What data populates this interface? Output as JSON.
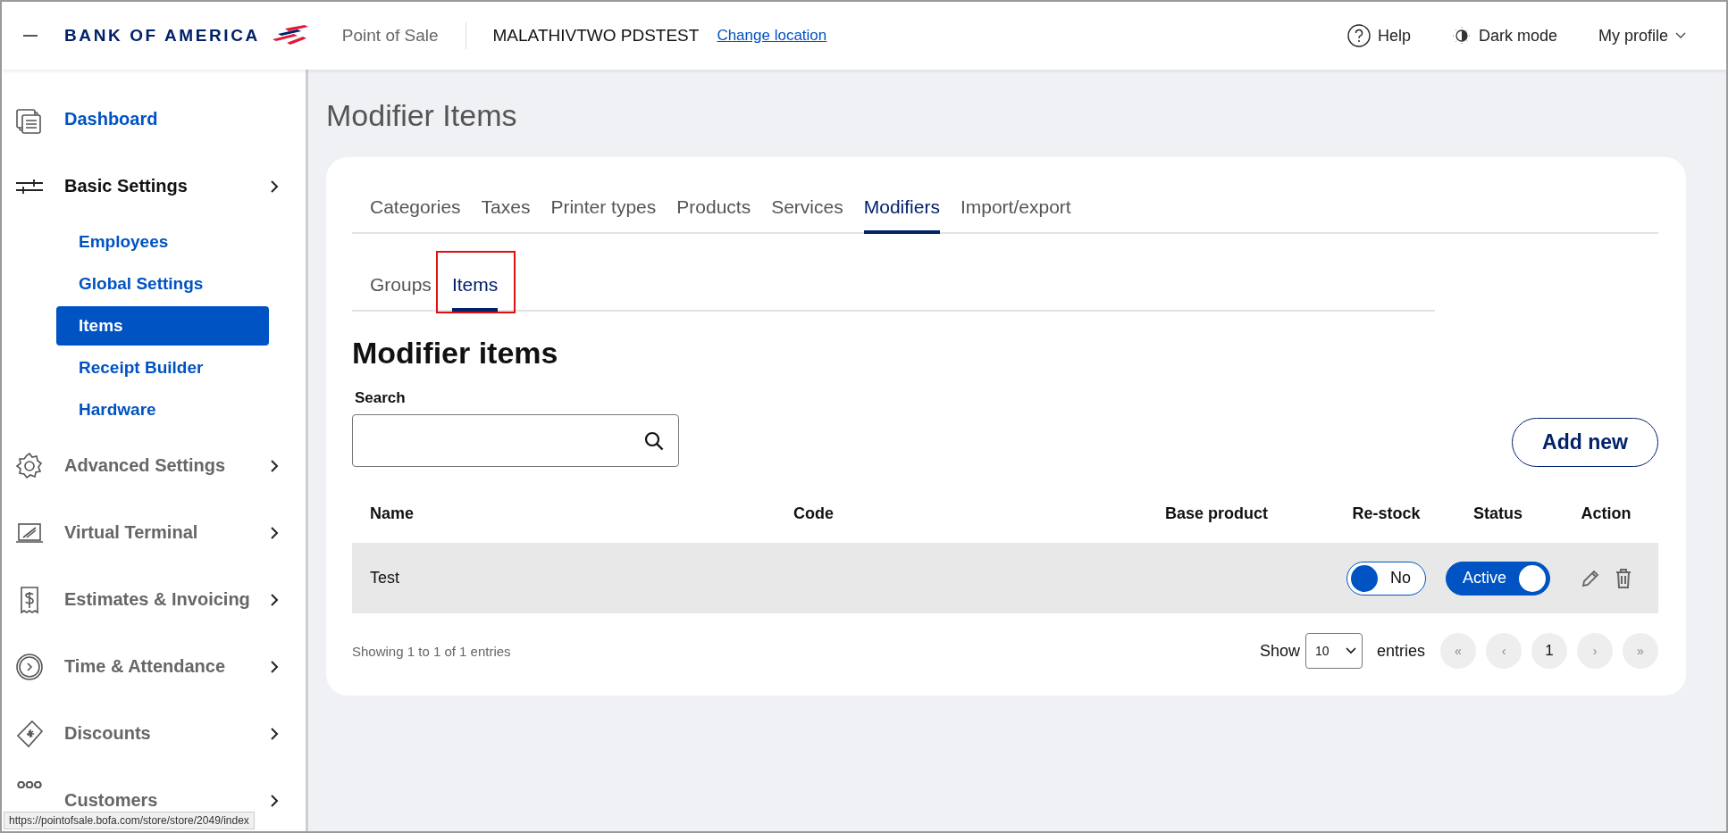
{
  "header": {
    "brand": "BANK OF AMERICA",
    "app_name": "Point of Sale",
    "location": "MALATHIVTWO PDSTEST",
    "change_location": "Change location",
    "help": "Help",
    "dark_mode": "Dark mode",
    "profile": "My profile"
  },
  "sidebar": {
    "items": [
      {
        "kind": "link",
        "label": "Dashboard"
      },
      {
        "kind": "section",
        "label": "Basic Settings",
        "selected": true,
        "children": [
          {
            "label": "Employees",
            "selected": false
          },
          {
            "label": "Global Settings",
            "selected": false
          },
          {
            "label": "Items",
            "selected": true
          },
          {
            "label": "Receipt Builder",
            "selected": false
          },
          {
            "label": "Hardware",
            "selected": false
          }
        ]
      },
      {
        "kind": "section",
        "label": "Advanced Settings",
        "selected": false
      },
      {
        "kind": "section",
        "label": "Virtual Terminal",
        "selected": false
      },
      {
        "kind": "section",
        "label": "Estimates & Invoicing",
        "selected": false
      },
      {
        "kind": "section",
        "label": "Time & Attendance",
        "selected": false
      },
      {
        "kind": "section",
        "label": "Discounts",
        "selected": false
      },
      {
        "kind": "section",
        "label": "Customers",
        "selected": false
      }
    ]
  },
  "page_title": "Modifier Items",
  "tabs": [
    {
      "label": "Categories",
      "selected": false
    },
    {
      "label": "Taxes",
      "selected": false
    },
    {
      "label": "Printer types",
      "selected": false
    },
    {
      "label": "Products",
      "selected": false
    },
    {
      "label": "Services",
      "selected": false
    },
    {
      "label": "Modifiers",
      "selected": true
    },
    {
      "label": "Import/export",
      "selected": false
    }
  ],
  "subtabs": [
    {
      "label": "Groups",
      "selected": false,
      "highlighted": false
    },
    {
      "label": "Items",
      "selected": true,
      "highlighted": true
    }
  ],
  "section_title": "Modifier items",
  "search": {
    "label": "Search"
  },
  "add_button": "Add new",
  "table": {
    "columns": [
      "Name",
      "Code",
      "Base product",
      "Re-stock",
      "Status",
      "Action"
    ],
    "rows": [
      {
        "name": "Test",
        "restock": {
          "on": false,
          "label": "No"
        },
        "status": {
          "on": true,
          "label": "Active"
        }
      }
    ]
  },
  "footer": {
    "info": "Showing 1 to 1 of 1 entries",
    "show_label": "Show",
    "page_size": "10",
    "entries_label": "entries",
    "pagination": [
      {
        "label": "«",
        "disabled": true
      },
      {
        "label": "‹",
        "disabled": true
      },
      {
        "label": "1",
        "disabled": false
      },
      {
        "label": "›",
        "disabled": true
      },
      {
        "label": "»",
        "disabled": true
      }
    ]
  },
  "status_url": "https://pointofsale.bofa.com/store/store/2049/index"
}
